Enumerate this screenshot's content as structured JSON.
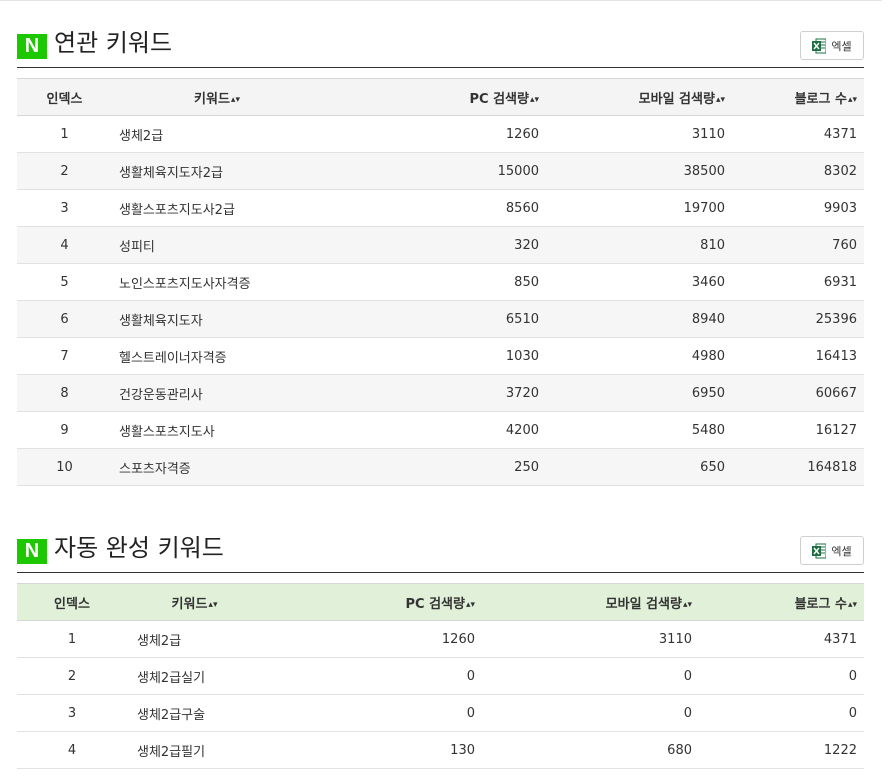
{
  "excel_label": "엑셀",
  "sort_glyph": "▴▾",
  "columns": {
    "index": "인덱스",
    "keyword": "키워드",
    "pc": "PC 검색량",
    "mobile": "모바일 검색량",
    "blog": "블로그 수"
  },
  "colors": {
    "naver_green": "#1ec800",
    "auto_header_bg": "#e0f0d9"
  },
  "related": {
    "logo": "N",
    "title": "연관 키워드",
    "rows": [
      {
        "index": "1",
        "keyword": "생체2급",
        "pc": "1260",
        "mobile": "3110",
        "blog": "4371"
      },
      {
        "index": "2",
        "keyword": "생활체육지도자2급",
        "pc": "15000",
        "mobile": "38500",
        "blog": "8302"
      },
      {
        "index": "3",
        "keyword": "생활스포츠지도사2급",
        "pc": "8560",
        "mobile": "19700",
        "blog": "9903"
      },
      {
        "index": "4",
        "keyword": "성피티",
        "pc": "320",
        "mobile": "810",
        "blog": "760"
      },
      {
        "index": "5",
        "keyword": "노인스포츠지도사자격증",
        "pc": "850",
        "mobile": "3460",
        "blog": "6931"
      },
      {
        "index": "6",
        "keyword": "생활체육지도자",
        "pc": "6510",
        "mobile": "8940",
        "blog": "25396"
      },
      {
        "index": "7",
        "keyword": "헬스트레이너자격증",
        "pc": "1030",
        "mobile": "4980",
        "blog": "16413"
      },
      {
        "index": "8",
        "keyword": "건강운동관리사",
        "pc": "3720",
        "mobile": "6950",
        "blog": "60667"
      },
      {
        "index": "9",
        "keyword": "생활스포츠지도사",
        "pc": "4200",
        "mobile": "5480",
        "blog": "16127"
      },
      {
        "index": "10",
        "keyword": "스포츠자격증",
        "pc": "250",
        "mobile": "650",
        "blog": "164818"
      }
    ]
  },
  "autocomplete": {
    "logo": "N",
    "title": "자동 완성 키워드",
    "rows": [
      {
        "index": "1",
        "keyword": "생체2급",
        "pc": "1260",
        "mobile": "3110",
        "blog": "4371"
      },
      {
        "index": "2",
        "keyword": "생체2급실기",
        "pc": "0",
        "mobile": "0",
        "blog": "0"
      },
      {
        "index": "3",
        "keyword": "생체2급구술",
        "pc": "0",
        "mobile": "0",
        "blog": "0"
      },
      {
        "index": "4",
        "keyword": "생체2급필기",
        "pc": "130",
        "mobile": "680",
        "blog": "1222"
      }
    ]
  }
}
